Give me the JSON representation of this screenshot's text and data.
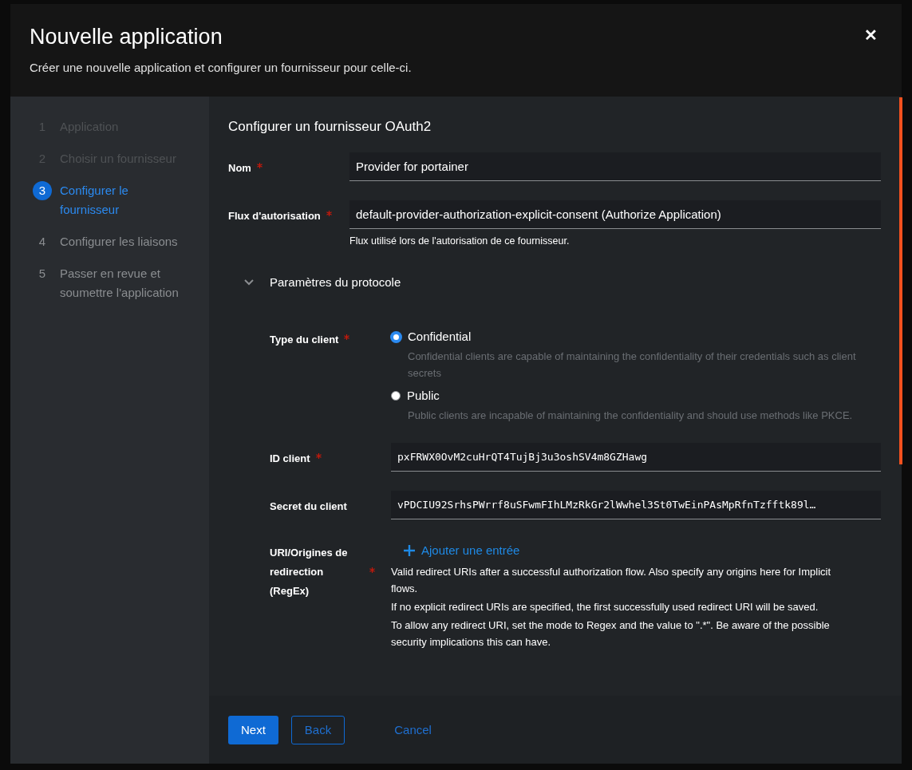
{
  "modal": {
    "title": "Nouvelle application",
    "subtitle": "Créer une nouvelle application et configurer un fournisseur pour celle-ci.",
    "close": "✕"
  },
  "steps": [
    {
      "number": "1",
      "label": "Application",
      "selected": false,
      "disabled": true
    },
    {
      "number": "2",
      "label": "Choisir un fournisseur",
      "selected": false,
      "disabled": true
    },
    {
      "number": "3",
      "label": "Configurer le fournisseur",
      "selected": true,
      "disabled": false
    },
    {
      "number": "4",
      "label": "Configurer les liaisons",
      "selected": false,
      "disabled": false
    },
    {
      "number": "5",
      "label": "Passer en revue et soumettre l'application",
      "selected": false,
      "disabled": false
    }
  ],
  "form": {
    "title": "Configurer un fournisseur OAuth2",
    "fields": [
      {
        "label": "Nom",
        "required": true,
        "value": "Provider for portainer"
      },
      {
        "label": "Flux d'autorisation",
        "required": true,
        "value": "default-provider-authorization-explicit-consent (Authorize Application)",
        "help": "Flux utilisé lors de l'autorisation de ce fournisseur."
      }
    ],
    "section": {
      "title": "Paramètres du protocole",
      "expanded": true,
      "client_type": {
        "label": "Type du client",
        "required": true,
        "options": [
          {
            "label": "Confidential",
            "description": "Confidential clients are capable of maintaining the confidentiality of their credentials such as client secrets",
            "selected": true
          },
          {
            "label": "Public",
            "description": "Public clients are incapable of maintaining the confidentiality and should use methods like PKCE.",
            "selected": false
          }
        ]
      },
      "fields": [
        {
          "label": "ID client",
          "required": true,
          "value": "pxFRWX0OvM2cuHrQT4TujBj3u3oshSV4m8GZHawg"
        },
        {
          "label": "Secret du client",
          "required": false,
          "value": "vPDCIU92SrhsPWrrf8uSFwmFIhLMzRkGr2lWwhel3St0TwEinPAsMpRfnTzfftk89l…"
        }
      ],
      "redirect": {
        "label": "URI/Origines de redirection (RegEx)",
        "required": true,
        "add_label": "Ajouter une entrée",
        "help": [
          "Valid redirect URIs after a successful authorization flow. Also specify any origins here for Implicit flows.",
          "If no explicit redirect URIs are specified, the first successfully used redirect URI will be saved.",
          "To allow any redirect URI, set the mode to Regex and the value to \".*\". Be aware of the possible security implications this can have."
        ]
      }
    }
  },
  "footer": {
    "buttons": [
      {
        "label": "Next",
        "kind": "primary"
      },
      {
        "label": "Back",
        "kind": "secondary"
      },
      {
        "label": "Cancel",
        "kind": "link"
      }
    ]
  }
}
